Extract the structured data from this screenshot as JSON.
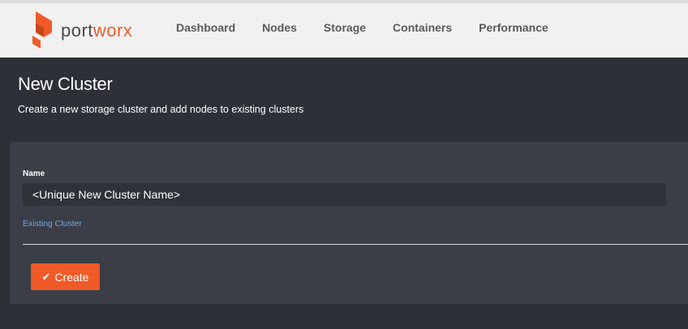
{
  "brand": {
    "name_prefix": "port",
    "name_suffix": "worx",
    "accent_color": "#f05a28"
  },
  "nav": {
    "items": [
      {
        "label": "Dashboard"
      },
      {
        "label": "Nodes"
      },
      {
        "label": "Storage"
      },
      {
        "label": "Containers"
      },
      {
        "label": "Performance"
      }
    ]
  },
  "page": {
    "title": "New Cluster",
    "subtitle": "Create a new storage cluster and add nodes to existing clusters"
  },
  "form": {
    "name_label": "Name",
    "name_value": "<Unique New Cluster Name>",
    "existing_link": "Existing Cluster",
    "create_label": "Create",
    "create_icon": "check-icon"
  }
}
